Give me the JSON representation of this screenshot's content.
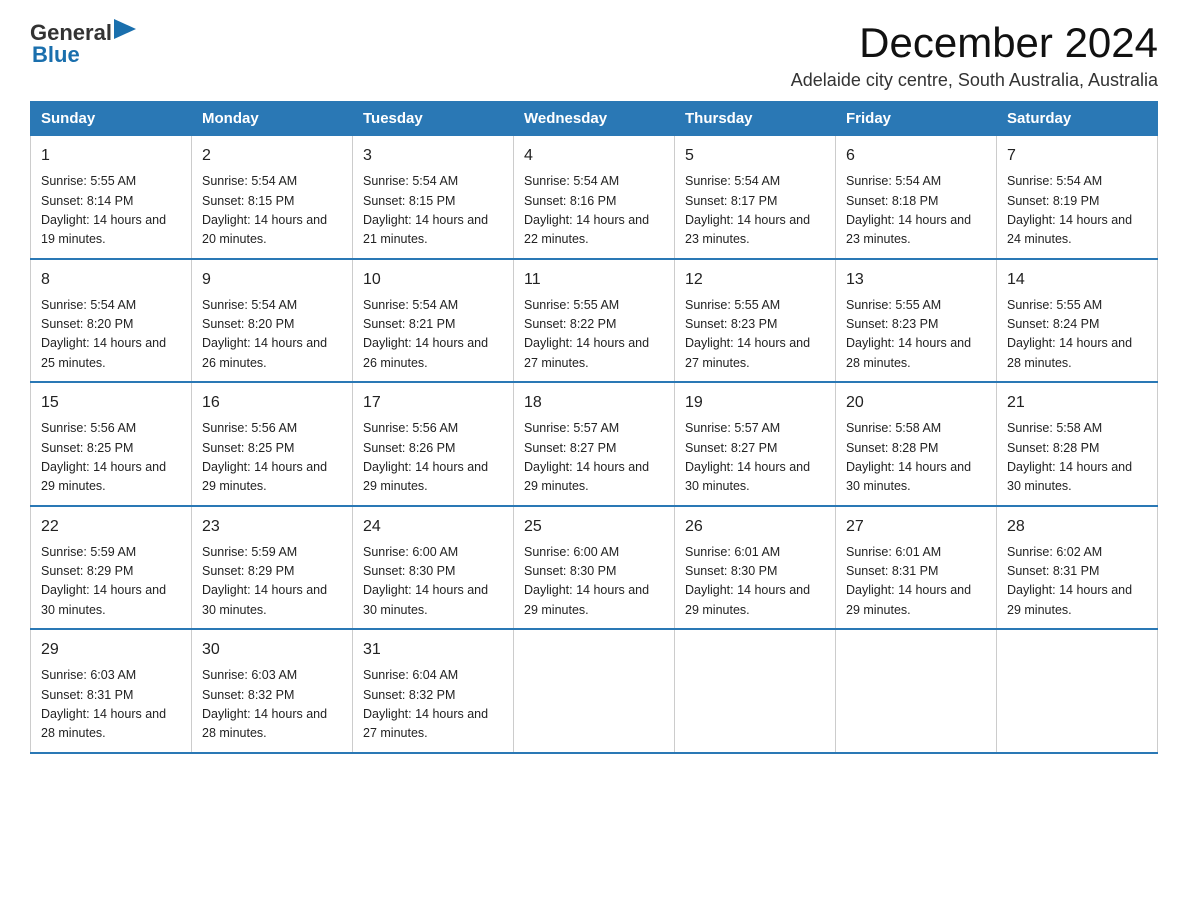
{
  "header": {
    "month_year": "December 2024",
    "location": "Adelaide city centre, South Australia, Australia",
    "logo_general": "General",
    "logo_blue": "Blue"
  },
  "days_of_week": [
    "Sunday",
    "Monday",
    "Tuesday",
    "Wednesday",
    "Thursday",
    "Friday",
    "Saturday"
  ],
  "weeks": [
    [
      {
        "day": "1",
        "sunrise": "5:55 AM",
        "sunset": "8:14 PM",
        "daylight": "14 hours and 19 minutes."
      },
      {
        "day": "2",
        "sunrise": "5:54 AM",
        "sunset": "8:15 PM",
        "daylight": "14 hours and 20 minutes."
      },
      {
        "day": "3",
        "sunrise": "5:54 AM",
        "sunset": "8:15 PM",
        "daylight": "14 hours and 21 minutes."
      },
      {
        "day": "4",
        "sunrise": "5:54 AM",
        "sunset": "8:16 PM",
        "daylight": "14 hours and 22 minutes."
      },
      {
        "day": "5",
        "sunrise": "5:54 AM",
        "sunset": "8:17 PM",
        "daylight": "14 hours and 23 minutes."
      },
      {
        "day": "6",
        "sunrise": "5:54 AM",
        "sunset": "8:18 PM",
        "daylight": "14 hours and 23 minutes."
      },
      {
        "day": "7",
        "sunrise": "5:54 AM",
        "sunset": "8:19 PM",
        "daylight": "14 hours and 24 minutes."
      }
    ],
    [
      {
        "day": "8",
        "sunrise": "5:54 AM",
        "sunset": "8:20 PM",
        "daylight": "14 hours and 25 minutes."
      },
      {
        "day": "9",
        "sunrise": "5:54 AM",
        "sunset": "8:20 PM",
        "daylight": "14 hours and 26 minutes."
      },
      {
        "day": "10",
        "sunrise": "5:54 AM",
        "sunset": "8:21 PM",
        "daylight": "14 hours and 26 minutes."
      },
      {
        "day": "11",
        "sunrise": "5:55 AM",
        "sunset": "8:22 PM",
        "daylight": "14 hours and 27 minutes."
      },
      {
        "day": "12",
        "sunrise": "5:55 AM",
        "sunset": "8:23 PM",
        "daylight": "14 hours and 27 minutes."
      },
      {
        "day": "13",
        "sunrise": "5:55 AM",
        "sunset": "8:23 PM",
        "daylight": "14 hours and 28 minutes."
      },
      {
        "day": "14",
        "sunrise": "5:55 AM",
        "sunset": "8:24 PM",
        "daylight": "14 hours and 28 minutes."
      }
    ],
    [
      {
        "day": "15",
        "sunrise": "5:56 AM",
        "sunset": "8:25 PM",
        "daylight": "14 hours and 29 minutes."
      },
      {
        "day": "16",
        "sunrise": "5:56 AM",
        "sunset": "8:25 PM",
        "daylight": "14 hours and 29 minutes."
      },
      {
        "day": "17",
        "sunrise": "5:56 AM",
        "sunset": "8:26 PM",
        "daylight": "14 hours and 29 minutes."
      },
      {
        "day": "18",
        "sunrise": "5:57 AM",
        "sunset": "8:27 PM",
        "daylight": "14 hours and 29 minutes."
      },
      {
        "day": "19",
        "sunrise": "5:57 AM",
        "sunset": "8:27 PM",
        "daylight": "14 hours and 30 minutes."
      },
      {
        "day": "20",
        "sunrise": "5:58 AM",
        "sunset": "8:28 PM",
        "daylight": "14 hours and 30 minutes."
      },
      {
        "day": "21",
        "sunrise": "5:58 AM",
        "sunset": "8:28 PM",
        "daylight": "14 hours and 30 minutes."
      }
    ],
    [
      {
        "day": "22",
        "sunrise": "5:59 AM",
        "sunset": "8:29 PM",
        "daylight": "14 hours and 30 minutes."
      },
      {
        "day": "23",
        "sunrise": "5:59 AM",
        "sunset": "8:29 PM",
        "daylight": "14 hours and 30 minutes."
      },
      {
        "day": "24",
        "sunrise": "6:00 AM",
        "sunset": "8:30 PM",
        "daylight": "14 hours and 30 minutes."
      },
      {
        "day": "25",
        "sunrise": "6:00 AM",
        "sunset": "8:30 PM",
        "daylight": "14 hours and 29 minutes."
      },
      {
        "day": "26",
        "sunrise": "6:01 AM",
        "sunset": "8:30 PM",
        "daylight": "14 hours and 29 minutes."
      },
      {
        "day": "27",
        "sunrise": "6:01 AM",
        "sunset": "8:31 PM",
        "daylight": "14 hours and 29 minutes."
      },
      {
        "day": "28",
        "sunrise": "6:02 AM",
        "sunset": "8:31 PM",
        "daylight": "14 hours and 29 minutes."
      }
    ],
    [
      {
        "day": "29",
        "sunrise": "6:03 AM",
        "sunset": "8:31 PM",
        "daylight": "14 hours and 28 minutes."
      },
      {
        "day": "30",
        "sunrise": "6:03 AM",
        "sunset": "8:32 PM",
        "daylight": "14 hours and 28 minutes."
      },
      {
        "day": "31",
        "sunrise": "6:04 AM",
        "sunset": "8:32 PM",
        "daylight": "14 hours and 27 minutes."
      },
      null,
      null,
      null,
      null
    ]
  ]
}
